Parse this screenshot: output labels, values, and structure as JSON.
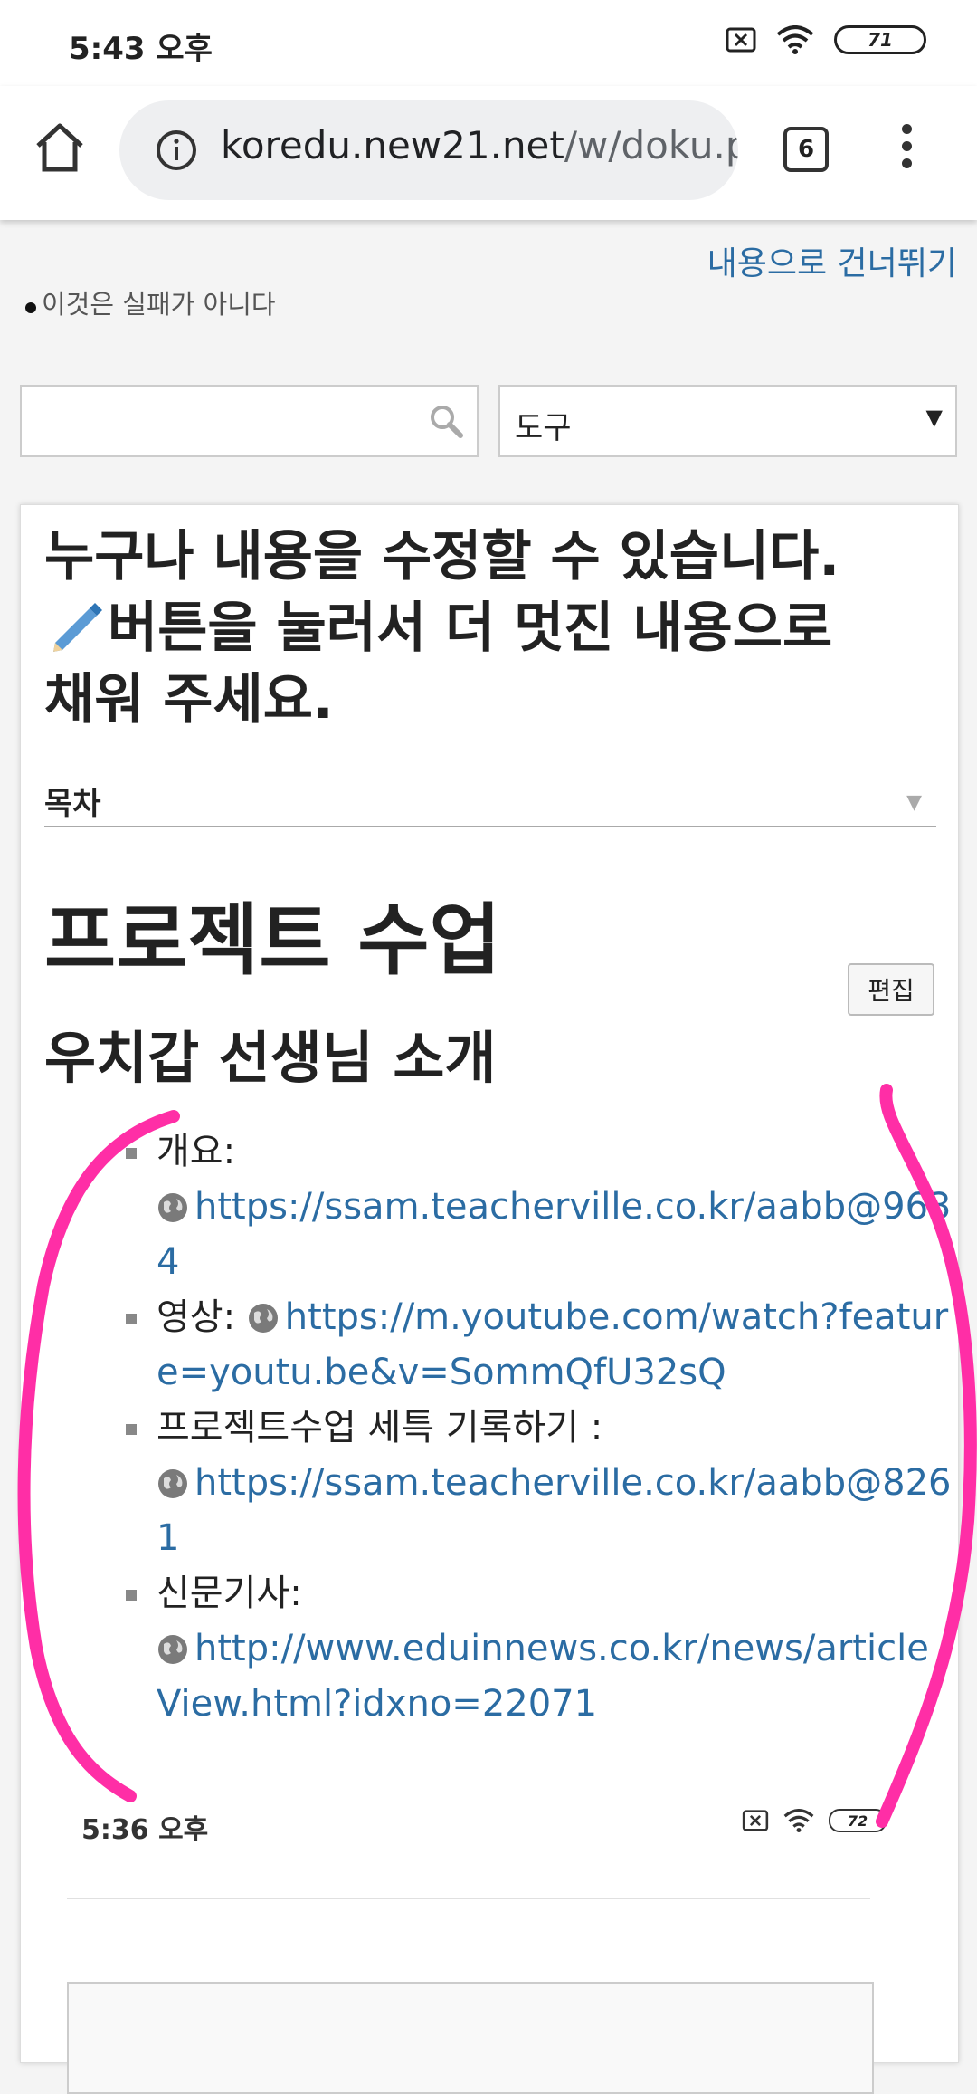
{
  "status_bar": {
    "time": "5:43 오후",
    "battery": "71"
  },
  "browser": {
    "url_host": "koredu.new21.net",
    "url_path": "/w/doku.p",
    "tab_count": "6"
  },
  "page": {
    "skip_link": "내용으로 건너뛰기",
    "site_logo": "이것은 실패가 아니다",
    "search": {
      "placeholder": ""
    },
    "tools_select": {
      "selected": "도구"
    },
    "notice_line1": "누구나 내용을 수정할 수 있습니다.",
    "notice_line2": "버튼을 눌러서 더 멋진 내용으로",
    "notice_line3": "채워 주세요.",
    "toc_label": "목차",
    "heading1": "프로젝트 수업",
    "edit_button": "편집",
    "heading2": "우치갑 선생님 소개",
    "items": [
      {
        "label": "개요:",
        "link": "https://ssam.teacherville.co.kr/aabb@9634"
      },
      {
        "label": "영상:",
        "link": "https://m.youtube.com/watch?feature=youtu.be&v=SommQfU32sQ"
      },
      {
        "label": "프로젝트수업 세특 기록하기 :",
        "link": "https://ssam.teacherville.co.kr/aabb@8261"
      },
      {
        "label": "신문기사:",
        "link": "http://www.eduinnews.co.kr/news/articleView.html?idxno=22071"
      }
    ],
    "embedded_status": {
      "time": "5:36 오후",
      "battery": "72"
    }
  },
  "colors": {
    "link": "#2b6ca3",
    "annotation": "#ff2ea6"
  }
}
